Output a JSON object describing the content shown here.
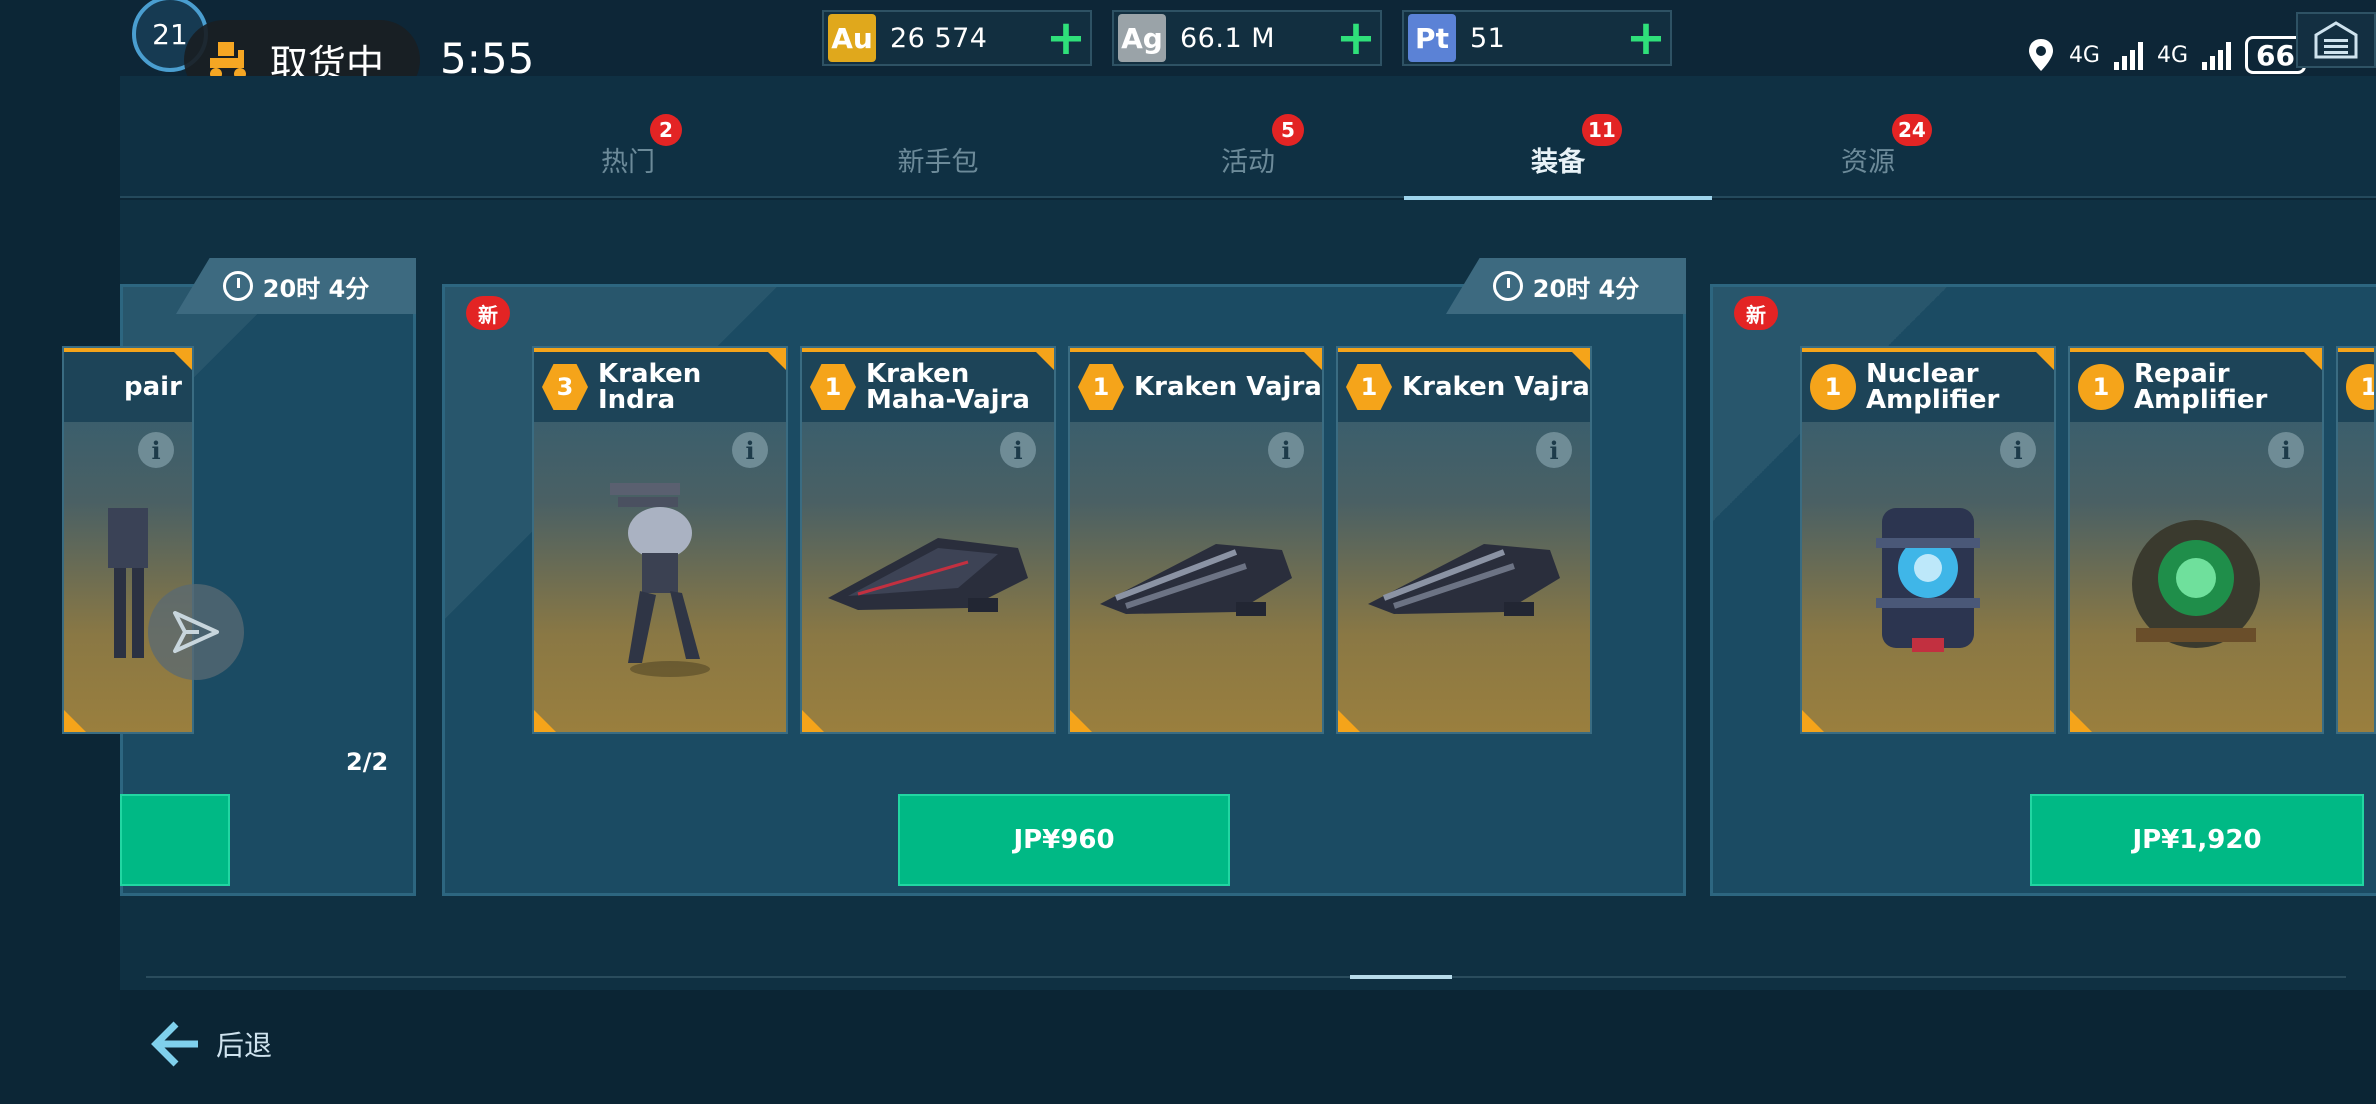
{
  "status_bar": {
    "level": "21",
    "pickup_label": "取货中",
    "time": "5:55",
    "network_1": "4G",
    "network_2": "4G",
    "battery": "66"
  },
  "currencies": [
    {
      "symbol": "Au",
      "amount": "26 574",
      "color": "#e0a81c"
    },
    {
      "symbol": "Ag",
      "amount": "66.1 M",
      "color": "#9aa3a8"
    },
    {
      "symbol": "Pt",
      "amount": "51",
      "color": "#5b82d6"
    }
  ],
  "tabs": [
    {
      "label": "热门",
      "badge": "2"
    },
    {
      "label": "新手包",
      "badge": ""
    },
    {
      "label": "活动",
      "badge": "5"
    },
    {
      "label": "装备",
      "badge": "11"
    },
    {
      "label": "资源",
      "badge": "24"
    }
  ],
  "active_tab": "装备",
  "offers": [
    {
      "timer": "20时 4分",
      "page_indicator": "2/2",
      "cards": [
        {
          "name": "pair",
          "qty": ""
        }
      ]
    },
    {
      "new_badge": "新",
      "timer": "20时 4分",
      "price": "JP¥960",
      "cards": [
        {
          "name": "Kraken Indra",
          "qty": "3"
        },
        {
          "name": "Kraken Maha-Vajra",
          "qty": "1"
        },
        {
          "name": "Kraken Vajra",
          "qty": "1"
        },
        {
          "name": "Kraken Vajra",
          "qty": "1"
        }
      ]
    },
    {
      "new_badge": "新",
      "price": "JP¥1,920",
      "cards": [
        {
          "name": "Nuclear Amplifier",
          "qty": "1"
        },
        {
          "name": "Repair Amplifier",
          "qty": "1"
        },
        {
          "name": "",
          "qty": "1"
        }
      ]
    }
  ],
  "back_label": "后退",
  "icons": {
    "info": "i",
    "plus": "+"
  }
}
